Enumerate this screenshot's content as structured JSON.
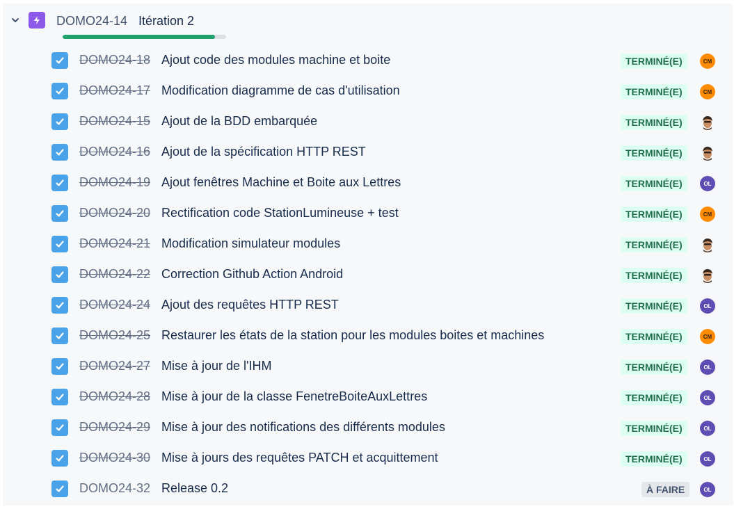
{
  "epic": {
    "key": "DOMO24-14",
    "title": "Itération 2",
    "progress_done_fraction": 0.93,
    "icon": "lightning-icon",
    "accent_color": "#8c59e8"
  },
  "issues": [
    {
      "key": "DOMO24-18",
      "title": "Ajout code des modules machine et boite",
      "status": "TERMINÉ(E)",
      "done": true,
      "assignee": "CM"
    },
    {
      "key": "DOMO24-17",
      "title": "Modification diagramme de cas d'utilisation",
      "status": "TERMINÉ(E)",
      "done": true,
      "assignee": "CM"
    },
    {
      "key": "DOMO24-15",
      "title": "Ajout de la BDD embarquée",
      "status": "TERMINÉ(E)",
      "done": true,
      "assignee": "photo"
    },
    {
      "key": "DOMO24-16",
      "title": "Ajout de la spécification HTTP REST",
      "status": "TERMINÉ(E)",
      "done": true,
      "assignee": "photo"
    },
    {
      "key": "DOMO24-19",
      "title": "Ajout fenêtres Machine et Boite aux Lettres",
      "status": "TERMINÉ(E)",
      "done": true,
      "assignee": "OL"
    },
    {
      "key": "DOMO24-20",
      "title": "Rectification code StationLumineuse + test",
      "status": "TERMINÉ(E)",
      "done": true,
      "assignee": "CM"
    },
    {
      "key": "DOMO24-21",
      "title": "Modification simulateur modules",
      "status": "TERMINÉ(E)",
      "done": true,
      "assignee": "photo"
    },
    {
      "key": "DOMO24-22",
      "title": "Correction Github Action Android",
      "status": "TERMINÉ(E)",
      "done": true,
      "assignee": "photo"
    },
    {
      "key": "DOMO24-24",
      "title": "Ajout des requêtes HTTP REST",
      "status": "TERMINÉ(E)",
      "done": true,
      "assignee": "OL"
    },
    {
      "key": "DOMO24-25",
      "title": "Restaurer les états de la station pour les modules boites et machines",
      "status": "TERMINÉ(E)",
      "done": true,
      "assignee": "CM"
    },
    {
      "key": "DOMO24-27",
      "title": "Mise à jour de l'IHM",
      "status": "TERMINÉ(E)",
      "done": true,
      "assignee": "OL"
    },
    {
      "key": "DOMO24-28",
      "title": "Mise à jour de la classe FenetreBoiteAuxLettres",
      "status": "TERMINÉ(E)",
      "done": true,
      "assignee": "OL"
    },
    {
      "key": "DOMO24-29",
      "title": "Mise à jour des notifications des différents modules",
      "status": "TERMINÉ(E)",
      "done": true,
      "assignee": "OL"
    },
    {
      "key": "DOMO24-30",
      "title": "Mise à jours des requêtes PATCH et acquittement",
      "status": "TERMINÉ(E)",
      "done": true,
      "assignee": "OL"
    },
    {
      "key": "DOMO24-32",
      "title": "Release 0.2",
      "status": "À FAIRE",
      "done": false,
      "assignee": "OL"
    }
  ],
  "colors": {
    "done_badge_bg": "#dcfff1",
    "done_badge_text": "#216e4e",
    "todo_badge_bg": "#e4e6ea",
    "progress_fill": "#22a06b",
    "checkbox": "#4aa3e8",
    "avatar_cm": "#ff8b00",
    "avatar_ol": "#5e4db2"
  }
}
